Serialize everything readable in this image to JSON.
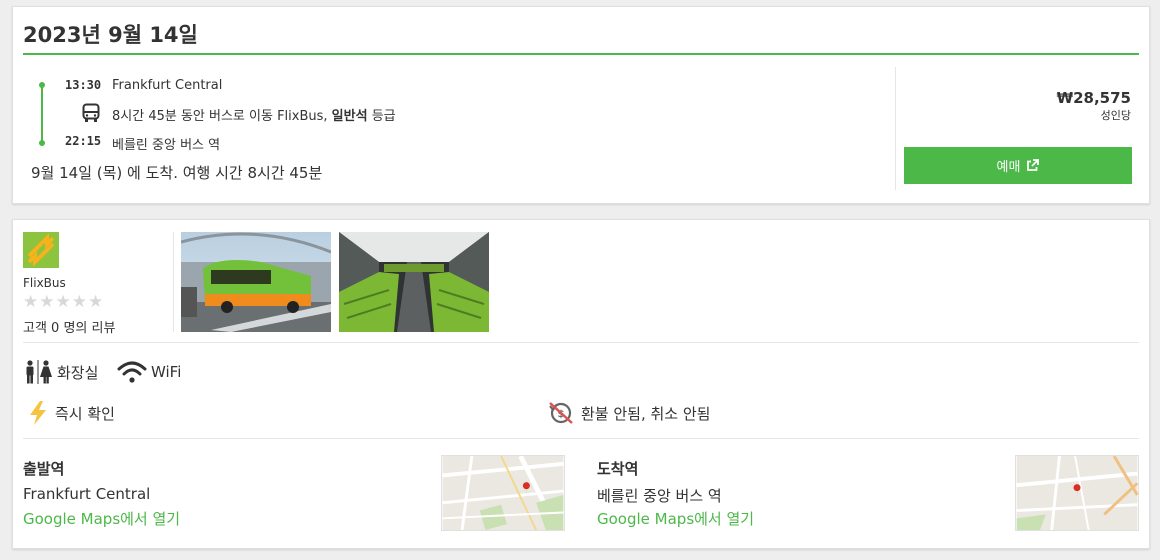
{
  "trip": {
    "date_title": "2023년 9월 14일",
    "departure_time": "13:30",
    "departure_station": "Frankfurt Central",
    "ride_prefix": "8시간 45분 동안 버스로 이동 FlixBus, ",
    "ride_class": "일반석",
    "ride_suffix": " 등급",
    "arrival_time": "22:15",
    "arrival_station": "베를린 중앙 버스 역",
    "arrival_note": "9월 14일 (목) 에 도착. 여행 시간 8시간 45분",
    "price": "₩28,575",
    "per_adult": "성인당",
    "book_label": "예매"
  },
  "operator": {
    "name": "FlixBus",
    "rating": 0,
    "max_rating": 5,
    "review_count_text": "고객 0 명의 리뷰"
  },
  "amenities": [
    {
      "icon": "restroom-icon",
      "label": "화장실"
    },
    {
      "icon": "wifi-icon",
      "label": "WiFi"
    }
  ],
  "features": {
    "instant": "즉시 확인",
    "refund": "환불 안됨, 취소 안됨"
  },
  "departure_section": {
    "title": "출발역",
    "station": "Frankfurt Central",
    "maps_link": "Google Maps에서 열기"
  },
  "arrival_section": {
    "title": "도착역",
    "station": "베를린 중앙 버스 역",
    "maps_link": "Google Maps에서 열기"
  },
  "colors": {
    "accent": "#4cb848",
    "logo": "#8cc43f",
    "lightning": "#f5c342",
    "no_refund_slash": "#e05050"
  }
}
